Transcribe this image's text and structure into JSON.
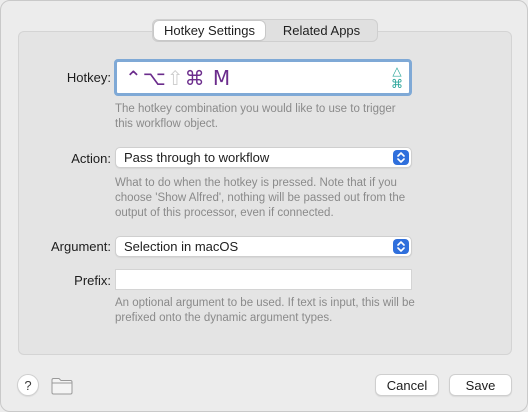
{
  "tabs": [
    {
      "label": "Hotkey Settings",
      "active": true
    },
    {
      "label": "Related Apps",
      "active": false
    }
  ],
  "hotkey": {
    "label": "Hotkey:",
    "modifiers": "⌃⌥",
    "shift": "⇧",
    "command_and_key": "⌘ M",
    "indicator_top": "△",
    "indicator_bottom": "⌘",
    "description": "The hotkey combination you would like to use to trigger this workflow object."
  },
  "action": {
    "label": "Action:",
    "value": "Pass through to workflow",
    "description": "What to do when the hotkey is pressed. Note that if you choose 'Show Alfred', nothing will be passed out from the output of this processor, even if connected."
  },
  "argument": {
    "label": "Argument:",
    "value": "Selection in macOS"
  },
  "prefix": {
    "label": "Prefix:",
    "value": "",
    "description": "An optional argument to be used. If text is input, this will be prefixed onto the dynamic argument types."
  },
  "footer": {
    "help_label": "?",
    "cancel_label": "Cancel",
    "save_label": "Save"
  },
  "colors": {
    "accent": "#2f6fdc",
    "hotkey_text": "#6b2c8c",
    "indicator": "#2aa59a"
  }
}
